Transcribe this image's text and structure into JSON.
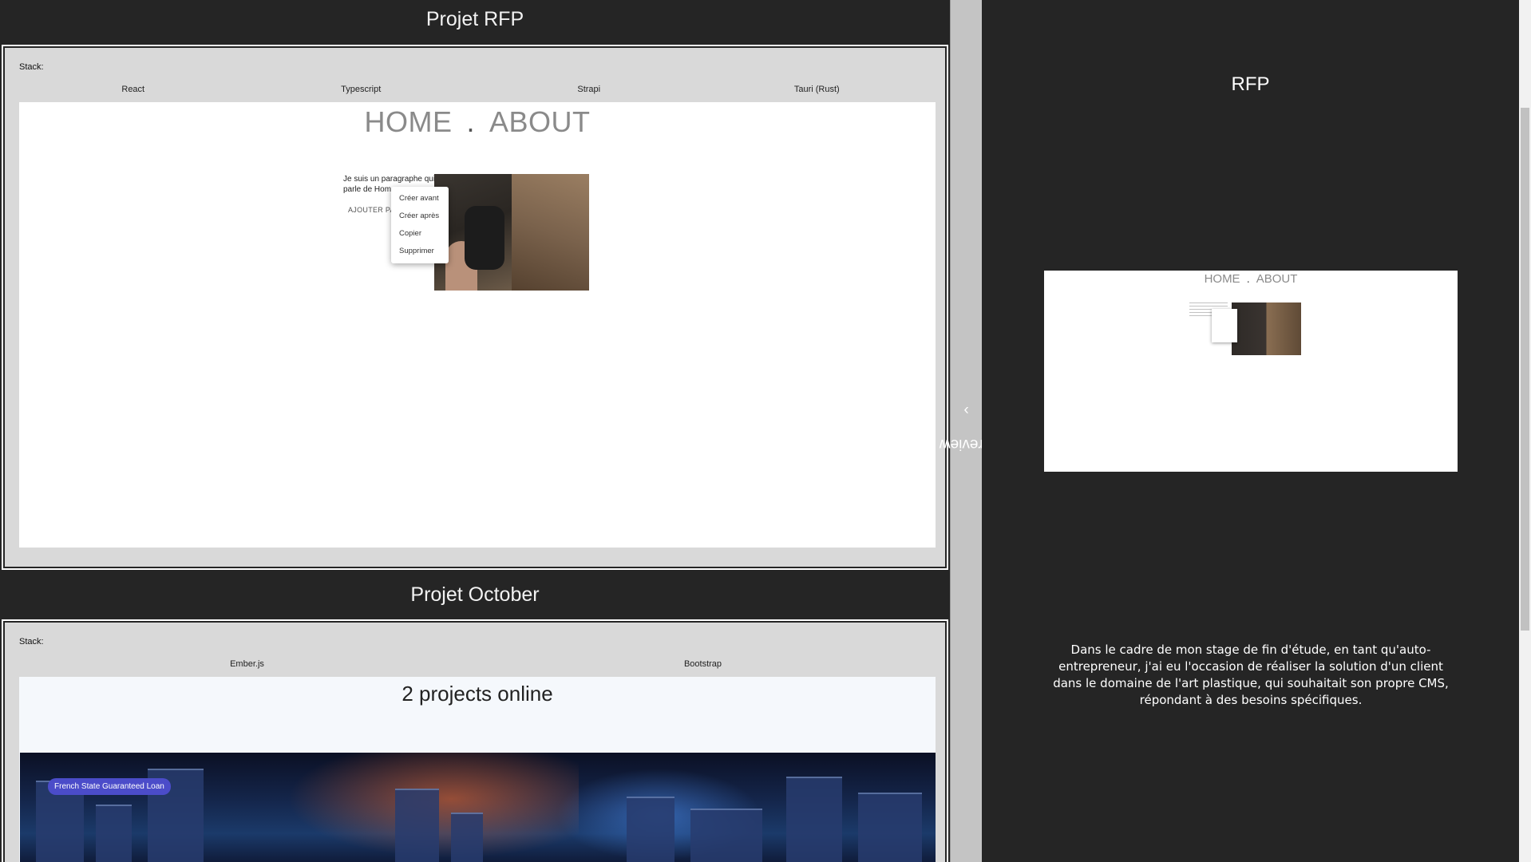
{
  "projects": [
    {
      "title": "Projet RFP",
      "stack_label": "Stack:",
      "stack": [
        "React",
        "Typescript",
        "Strapi",
        "Tauri (Rust)"
      ],
      "screenshot": {
        "nav_home": "HOME",
        "nav_separator": ".",
        "nav_about": "ABOUT",
        "paragraph": "Je suis un paragraphe qui parle de Hom",
        "add_button": "AJOUTER PA",
        "context_menu": [
          "Créer avant",
          "Créer après",
          "Copier",
          "Supprimer"
        ]
      }
    },
    {
      "title": "Projet October",
      "stack_label": "Stack:",
      "stack": [
        "Ember.js",
        "Bootstrap"
      ],
      "screenshot": {
        "heading": "2 projects online",
        "badge": "French State Guaranteed Loan"
      }
    }
  ],
  "splitter": {
    "label": "Preview",
    "chevron": "chevron-right-icon"
  },
  "preview": {
    "title": "RFP",
    "thumb_nav_home": "HOME",
    "thumb_nav_separator": ".",
    "thumb_nav_about": "ABOUT",
    "description": "Dans le cadre de mon stage de fin d'étude, en tant qu'auto-entrepreneur, j'ai eu l'occasion de réaliser la solution d'un client dans le domaine de l'art plastique, qui souhaitait son propre CMS, répondant à des besoins spécifiques."
  }
}
